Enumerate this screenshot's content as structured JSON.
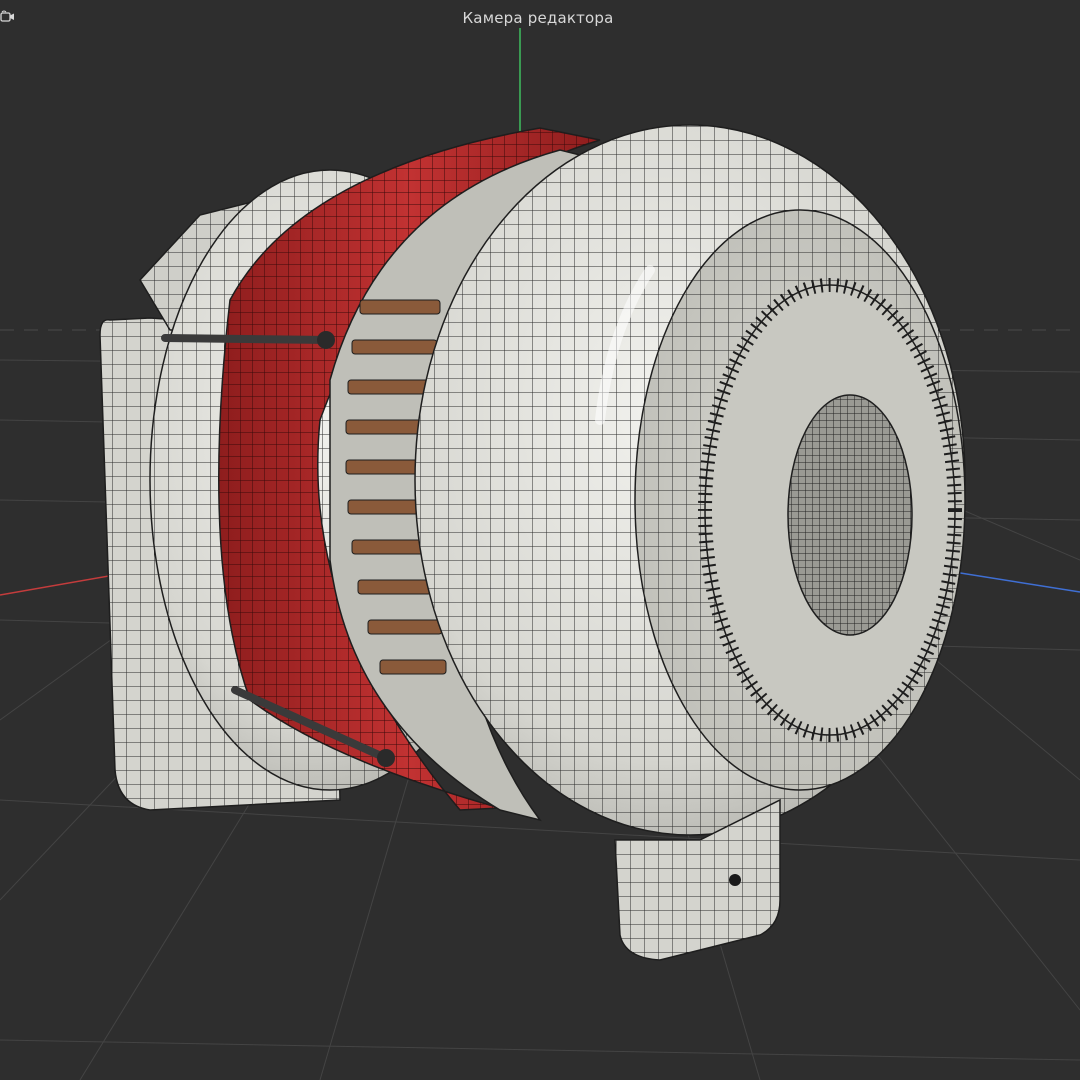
{
  "viewport": {
    "camera_label": "Камера редактора",
    "camera_icon": "camera-icon",
    "colors": {
      "background": "#2e2e2e",
      "grid": "#454545",
      "axis_x": "#c43c3c",
      "axis_y": "#3fbf5f",
      "axis_z": "#3f6fd4",
      "model_body": "#dcdcd6",
      "model_band": "#b02a2a",
      "wire": "#1e1e1e"
    }
  }
}
